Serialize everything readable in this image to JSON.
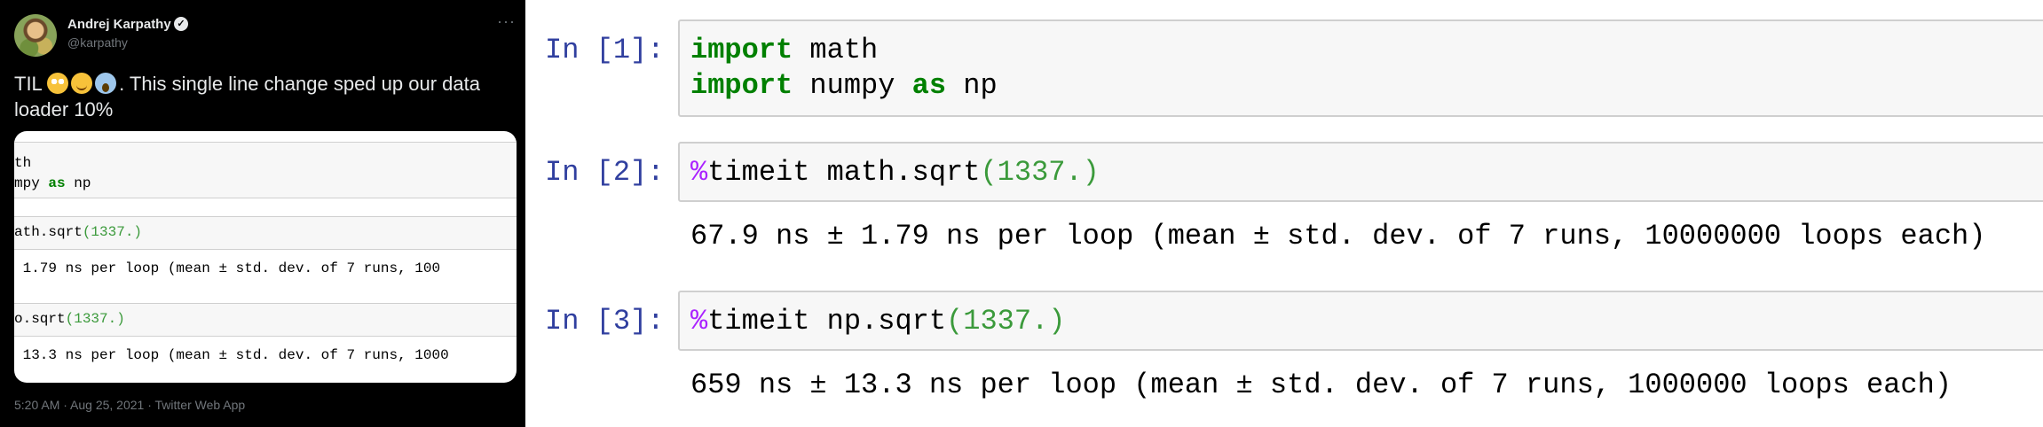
{
  "tweet": {
    "author_name": "Andrej Karpathy",
    "handle": "@karpathy",
    "more_label": "···",
    "text_prefix": "TIL ",
    "text_suffix": ". This single line change sped up our data loader 10%",
    "emojis": [
      "flushed-face",
      "relieved-face",
      "face-screaming-in-fear"
    ],
    "timestamp": "5:20 AM · Aug 25, 2021 · Twitter Web App",
    "snippet": {
      "cell1_line1": "th",
      "cell1_line2_pre": "mpy ",
      "cell1_line2_kw": "as",
      "cell1_line2_post": " np",
      "cell2_pre": "ath.sqrt",
      "cell2_num": "(1337.)",
      "cell2_output": " 1.79 ns per loop (mean ± std. dev. of 7 runs, 100",
      "cell3_pre": "o.sqrt",
      "cell3_num": "(1337.)",
      "cell3_output": " 13.3 ns per loop (mean ± std. dev. of 7 runs, 1000"
    }
  },
  "notebook": {
    "cells": [
      {
        "prompt": "In [1]:",
        "line1_kw": "import",
        "line1_rest": " math",
        "line2_kw": "import",
        "line2_mid": " numpy ",
        "line2_kw2": "as",
        "line2_rest": " np"
      },
      {
        "prompt": "In [2]:",
        "magic": "%",
        "code": "timeit math.sqrt",
        "arg": "(1337.)",
        "output": "67.9 ns ± 1.79 ns per loop (mean ± std. dev. of 7 runs, 10000000 loops each)"
      },
      {
        "prompt": "In [3]:",
        "magic": "%",
        "code": "timeit np.sqrt",
        "arg": "(1337.)",
        "output": "659 ns ± 13.3 ns per loop (mean ± std. dev. of 7 runs, 1000000 loops each)"
      }
    ]
  },
  "colors": {
    "prompt": "#303f9f",
    "keyword": "#008000",
    "number": "#3b9a3b",
    "magic": "#aa22ff",
    "tweet_background": "#000000"
  }
}
